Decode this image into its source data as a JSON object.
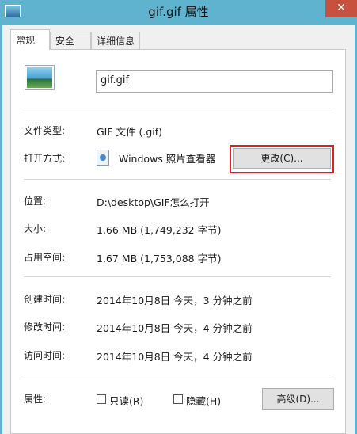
{
  "window": {
    "title": "gif.gif 属性",
    "close_glyph": "✕"
  },
  "tabs": [
    {
      "label": "常规",
      "active": true
    },
    {
      "label": "安全",
      "active": false
    },
    {
      "label": "详细信息",
      "active": false
    }
  ],
  "file_name": "gif.gif",
  "rows": {
    "type": {
      "label": "文件类型:",
      "value": "GIF 文件 (.gif)"
    },
    "opens_with": {
      "label": "打开方式:",
      "value": "Windows 照片查看器",
      "change_button": "更改(C)..."
    },
    "location": {
      "label": "位置:",
      "value": "D:\\desktop\\GIF怎么打开"
    },
    "size": {
      "label": "大小:",
      "value": "1.66 MB (1,749,232 字节)"
    },
    "size_on_disk": {
      "label": "占用空间:",
      "value": "1.67 MB (1,753,088 字节)"
    },
    "created": {
      "label": "创建时间:",
      "value": "2014年10月8日 今天，3 分钟之前"
    },
    "modified": {
      "label": "修改时间:",
      "value": "2014年10月8日 今天，4 分钟之前"
    },
    "accessed": {
      "label": "访问时间:",
      "value": "2014年10月8日 今天，4 分钟之前"
    }
  },
  "attributes": {
    "label": "属性:",
    "readonly": {
      "label": "只读(R)",
      "checked": false
    },
    "hidden": {
      "label": "隐藏(H)",
      "checked": false
    },
    "advanced_button": "高级(D)..."
  },
  "colors": {
    "title_bar": "#5fb3cf",
    "close_button": "#c7503e",
    "highlight": "#e02020"
  }
}
